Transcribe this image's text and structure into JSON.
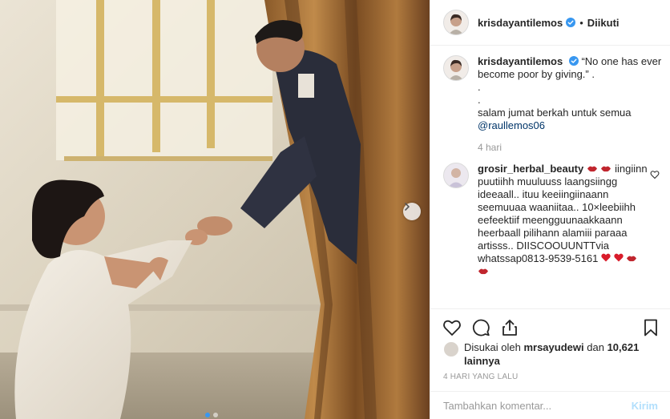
{
  "colors": {
    "link": "#003569",
    "muted": "#999999",
    "verified": "#3897f0",
    "heart": "#ed4956",
    "post_button": "#b2dffc"
  },
  "header": {
    "username": "krisdayantilemos",
    "separator": "•",
    "follow_state": "Diikuti"
  },
  "caption": {
    "username": "krisdayantilemos",
    "lines": [
      "“No one has ever become poor by giving.” .",
      ".",
      ".",
      "salam jumat berkah untuk semua"
    ],
    "mention": "@raullemos06",
    "age": "4 hari"
  },
  "comment": {
    "username": "grosir_herbal_beauty",
    "text": "iingiinn puutiihh muuluuss laangsiingg ideeaall.. ituu keeiingiinaann seemuuaa waaniitaa.. 10×leebiihh eefeektiif meengguunaakkaann heerbaall pilihann alamiii paraaa artisss.. DIISCOOUUNTTvia whatssap0813-9539-5161",
    "emoji_icons": [
      "lips-icon",
      "lips-icon",
      "red-heart-icon",
      "red-heart-icon",
      "lips-icon",
      "lips-icon"
    ]
  },
  "actions": {
    "like": "heart-icon",
    "comment": "comment-icon",
    "share": "share-icon",
    "save": "bookmark-icon"
  },
  "likes": {
    "prefix": "Disukai oleh",
    "user": "mrsayudewi",
    "connector": "dan",
    "count": "10,621",
    "suffix": "lainnya"
  },
  "timestamp": "4 HARI YANG LALU",
  "composer": {
    "placeholder": "Tambahkan komentar...",
    "submit": "Kirim"
  },
  "carousel": {
    "slide_count": 2,
    "active_slide": 1
  }
}
